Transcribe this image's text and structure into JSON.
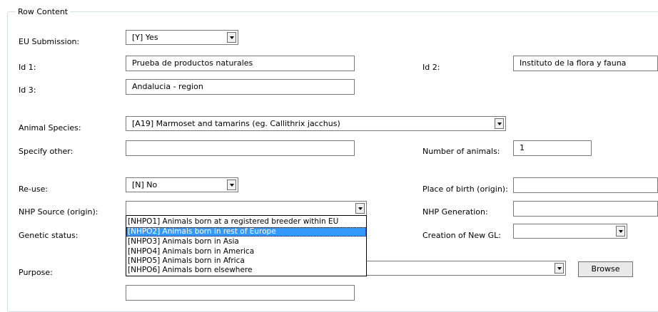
{
  "group_title": "Row Content",
  "fields": {
    "eu_submission": {
      "label": "EU Submission:",
      "value": "[Y] Yes"
    },
    "id1": {
      "label": "Id 1:",
      "value": "Prueba de productos naturales"
    },
    "id2": {
      "label": "Id 2:",
      "value": "Instituto de la flora y fauna"
    },
    "id3": {
      "label": "Id 3:",
      "value": "Andalucia - region"
    },
    "animal_species": {
      "label": "Animal Species:",
      "value": "[A19] Marmoset and tamarins (eg. Callithrix jacchus)"
    },
    "specify_other": {
      "label": "Specify other:",
      "value": ""
    },
    "number_of_animals": {
      "label": "Number of animals:",
      "value": "1"
    },
    "reuse": {
      "label": "Re-use:",
      "value": "[N] No"
    },
    "place_of_birth": {
      "label": "Place of birth (origin):",
      "value": ""
    },
    "nhp_source": {
      "label": "NHP Source (origin):",
      "value": ""
    },
    "nhp_generation": {
      "label": "NHP Generation:",
      "value": ""
    },
    "genetic_status": {
      "label": "Genetic status:"
    },
    "creation_new_gl": {
      "label": "Creation of New GL:",
      "value": ""
    },
    "purpose": {
      "label": "Purpose:",
      "value": ""
    }
  },
  "browse_label": "Browse",
  "nhp_source_options": [
    "[NHPO1] Animals born at a registered breeder within EU",
    "[NHPO2] Animals born in rest of Europe",
    "[NHPO3] Animals born in Asia",
    "[NHPO4] Animals born in America",
    "[NHPO5] Animals born in Africa",
    "[NHPO6] Animals born elsewhere"
  ],
  "nhp_source_highlighted_index": 1
}
